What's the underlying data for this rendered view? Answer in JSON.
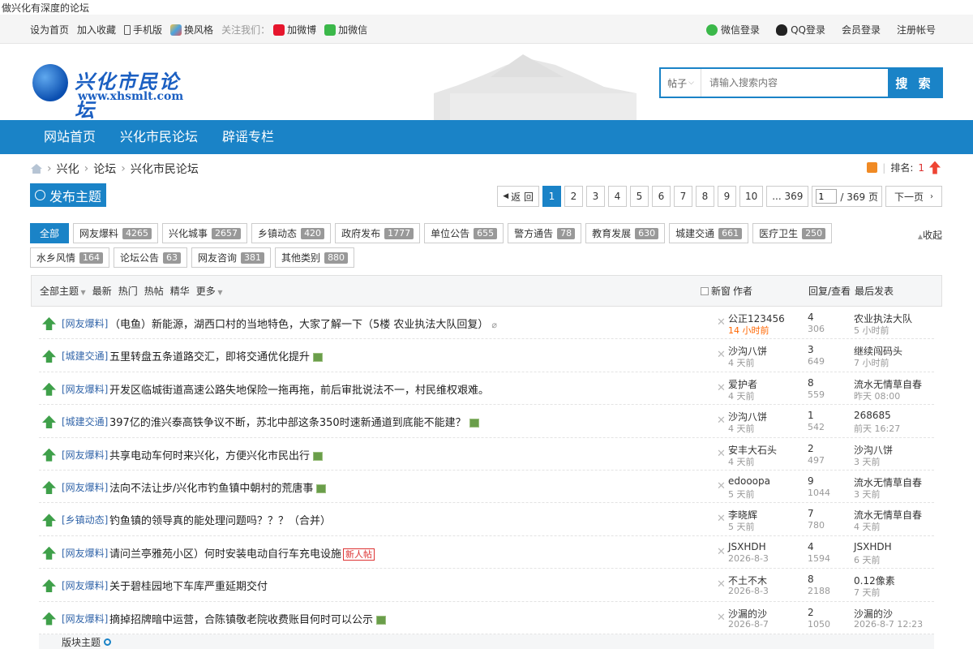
{
  "tagline": "做兴化有深度的论坛",
  "topbar": {
    "set_home": "设为首页",
    "add_fav": "加入收藏",
    "mobile": "手机版",
    "skin": "换风格",
    "follow": "关注我们：",
    "weibo": "加微博",
    "wechat": "加微信",
    "wx_login": "微信登录",
    "qq_login": "QQ登录",
    "member_login": "会员登录",
    "register": "注册帐号"
  },
  "logo": {
    "title": "兴化市民论坛",
    "url": "www.xhsmlt.com"
  },
  "search": {
    "scope": "帖子",
    "placeholder": "请输入搜索内容",
    "button": "搜 索"
  },
  "nav": [
    "网站首页",
    "兴化市民论坛",
    "辟谣专栏"
  ],
  "breadcrumb": [
    "兴化",
    "论坛",
    "兴化市民论坛"
  ],
  "rank": {
    "label": "排名:",
    "value": "1"
  },
  "post_button": "发布主题",
  "pager": {
    "back": "返 回",
    "pages": [
      "1",
      "2",
      "3",
      "4",
      "5",
      "6",
      "7",
      "8",
      "9",
      "10"
    ],
    "last": "... 369",
    "input_value": "1",
    "total": "/ 369 页",
    "next": "下一页"
  },
  "categories": [
    {
      "label": "全部",
      "count": ""
    },
    {
      "label": "网友爆料",
      "count": "4265"
    },
    {
      "label": "兴化城事",
      "count": "2657"
    },
    {
      "label": "乡镇动态",
      "count": "420"
    },
    {
      "label": "政府发布",
      "count": "1777"
    },
    {
      "label": "单位公告",
      "count": "655"
    },
    {
      "label": "警方通告",
      "count": "78"
    },
    {
      "label": "教育发展",
      "count": "630"
    },
    {
      "label": "城建交通",
      "count": "661"
    },
    {
      "label": "医疗卫生",
      "count": "250"
    },
    {
      "label": "水乡风情",
      "count": "164"
    },
    {
      "label": "论坛公告",
      "count": "63"
    },
    {
      "label": "网友咨询",
      "count": "381"
    },
    {
      "label": "其他类别",
      "count": "880"
    }
  ],
  "collapse": "收起",
  "table_head": {
    "filters": [
      "全部主题",
      "最新",
      "热门",
      "热帖",
      "精华",
      "更多"
    ],
    "new_window": "新窗",
    "author": "作者",
    "reply_view": "回复/查看",
    "last_post": "最后发表"
  },
  "threads": [
    {
      "tag": "[网友爆料]",
      "title": "（电鱼）新能源，湖西口村的当地特色，大家了解一下（5楼 农业执法大队回复）",
      "mark": "clip",
      "author": "公正123456",
      "time": "14 小时前",
      "hot": true,
      "replies": "4",
      "views": "306",
      "last_user": "农业执法大队",
      "last_time": "5 小时前"
    },
    {
      "tag": "[城建交通]",
      "title": "五里转盘五条道路交汇，即将交通优化提升",
      "mark": "pic",
      "author": "沙沟八饼",
      "time": "4 天前",
      "hot": false,
      "replies": "3",
      "views": "649",
      "last_user": "继续闯码头",
      "last_time": "7 小时前"
    },
    {
      "tag": "[网友爆料]",
      "title": "开发区临城街道高速公路失地保险一拖再拖，前后审批说法不一，村民维权艰难。",
      "mark": "",
      "author": "爱护者",
      "time": "4 天前",
      "hot": false,
      "replies": "8",
      "views": "559",
      "last_user": "流水无情草自春",
      "last_time": "昨天 08:00"
    },
    {
      "tag": "[城建交通]",
      "title": "397亿的淮兴泰高铁争议不断，苏北中部这条350时速新通道到底能不能建？",
      "mark": "pic",
      "author": "沙沟八饼",
      "time": "4 天前",
      "hot": false,
      "replies": "1",
      "views": "542",
      "last_user": "268685",
      "last_time": "前天 16:27"
    },
    {
      "tag": "[网友爆料]",
      "title": "共享电动车何时来兴化，方便兴化市民出行",
      "mark": "pic",
      "author": "安丰大石头",
      "time": "4 天前",
      "hot": false,
      "replies": "2",
      "views": "497",
      "last_user": "沙沟八饼",
      "last_time": "3 天前"
    },
    {
      "tag": "[网友爆料]",
      "title": "法向不法让步/兴化市钓鱼镇中朝村的荒唐事",
      "mark": "pic",
      "author": "edooopa",
      "time": "5 天前",
      "hot": false,
      "replies": "9",
      "views": "1044",
      "last_user": "流水无情草自春",
      "last_time": "3 天前"
    },
    {
      "tag": "[乡镇动态]",
      "title": "钓鱼镇的领导真的能处理问题吗？？？（合并）",
      "mark": "",
      "author": "李晓辉",
      "time": "5 天前",
      "hot": false,
      "replies": "7",
      "views": "780",
      "last_user": "流水无情草自春",
      "last_time": "4 天前"
    },
    {
      "tag": "[网友爆料]",
      "title": "请问兰亭雅苑小区）何时安装电动自行车充电设施",
      "mark": "new",
      "new_label": "新人帖",
      "author": "JSXHDH",
      "time": "2026-8-3",
      "hot": false,
      "replies": "4",
      "views": "1594",
      "last_user": "JSXHDH",
      "last_time": "6 天前"
    },
    {
      "tag": "[网友爆料]",
      "title": "关于碧桂园地下车库严重延期交付",
      "mark": "",
      "author": "不土不木",
      "time": "2026-8-3",
      "hot": false,
      "replies": "8",
      "views": "2188",
      "last_user": "0.12像素",
      "last_time": "7 天前"
    },
    {
      "tag": "[网友爆料]",
      "title": "摘掉招牌暗中运营，合陈镇敬老院收费账目何时可以公示",
      "mark": "pic",
      "author": "沙漏的沙",
      "time": "2026-8-7",
      "hot": false,
      "replies": "2",
      "views": "1050",
      "last_user": "沙漏的沙",
      "last_time": "2026-8-7 12:23"
    }
  ],
  "section_footer": "版块主题"
}
